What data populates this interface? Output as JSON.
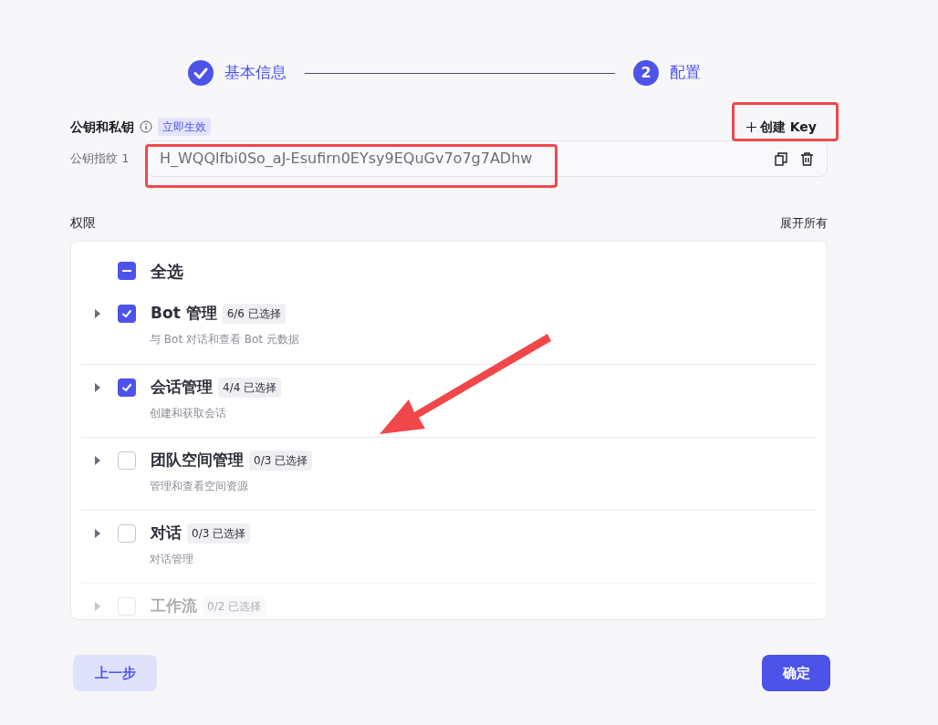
{
  "steps": [
    {
      "kind": "done",
      "label": "基本信息"
    },
    {
      "kind": "current",
      "number": "2",
      "label": "配置"
    }
  ],
  "keys": {
    "title": "公钥和私钥",
    "badge": "立即生效",
    "create_button": "创建 Key",
    "fingerprints": [
      {
        "label": "公钥指纹 1",
        "value": "H_WQQlfbi0So_aJ-Esufirn0EYsy9EQuGv7o7g7ADhw"
      }
    ]
  },
  "permissions": {
    "title": "权限",
    "expand_all": "展开所有",
    "select_all": {
      "label": "全选",
      "indeterminate": true
    },
    "groups": [
      {
        "name": "Bot 管理",
        "count": "6/6 已选择",
        "description": "与 Bot 对话和查看 Bot 元数据",
        "checked": true,
        "expanded": false
      },
      {
        "name": "会话管理",
        "count": "4/4 已选择",
        "description": "创建和获取会话",
        "checked": true,
        "expanded": false
      },
      {
        "name": "团队空间管理",
        "count": "0/3 已选择",
        "description": "管理和查看空间资源",
        "checked": false,
        "expanded": false
      },
      {
        "name": "对话",
        "count": "0/3 已选择",
        "description": "对话管理",
        "checked": false,
        "expanded": false
      },
      {
        "name": "工作流",
        "count": "0/2 已选择",
        "checked": false,
        "expanded": false
      }
    ]
  },
  "buttons": {
    "back": "上一步",
    "confirm": "确定"
  }
}
